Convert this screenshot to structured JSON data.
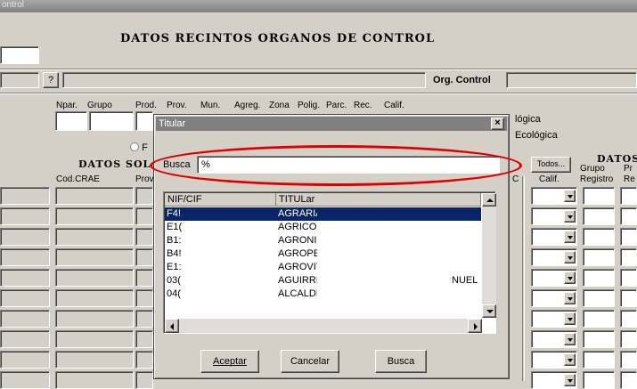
{
  "window": {
    "title_partial": "ontrol"
  },
  "header": {
    "title": "DATOS RECINTOS ORGANOS DE CONTROL",
    "help_button": "?",
    "org_control_label": "Org. Control"
  },
  "columns": {
    "npar": "Npar.",
    "grupo": "Grupo",
    "prod": "Prod.",
    "prov": "Prov.",
    "mun": "Mun.",
    "agreg": "Agreg.",
    "zona": "Zona",
    "polig": "Polig.",
    "parc": "Parc.",
    "rec": "Rec.",
    "calif": "Calif."
  },
  "left_panel": {
    "section_title": "DATOS SOL",
    "radio_label": "F",
    "col_cod_crae": "Cod.CRAE",
    "col_prov": "Prov"
  },
  "right_panel": {
    "line1": "lógica",
    "line2": "Ecológica",
    "todos_button": "Todos...",
    "section_title": "DATOS",
    "col_calif": "Calif.",
    "col_grupo": "Grupo",
    "col_registro": "Registro",
    "col_p": "Pr",
    "col_re": "Re",
    "c_label": "C"
  },
  "dialog": {
    "title": "Titular",
    "close": "×",
    "search_label": "Busca",
    "search_value": "%",
    "col_nif": "NIF/CIF",
    "col_titular": "TITULar",
    "rows": [
      {
        "nif": "F4!",
        "titular": "AGRARIA",
        "extra": ""
      },
      {
        "nif": "E1(",
        "titular": "AGRICOI",
        "extra": ""
      },
      {
        "nif": "B1:",
        "titular": "AGRONII",
        "extra": ""
      },
      {
        "nif": "B4!",
        "titular": "AGROPE",
        "extra": ""
      },
      {
        "nif": "E1:",
        "titular": "AGROVIT",
        "extra": ""
      },
      {
        "nif": "03(",
        "titular": "AGUIRRI",
        "extra": "NUEL"
      },
      {
        "nif": "04(",
        "titular": "ALCALDI",
        "extra": ""
      }
    ],
    "accept_button": "Aceptar",
    "cancel_button": "Cancelar",
    "search_button": "Busca"
  },
  "highlight": {
    "color": "#e00000"
  }
}
